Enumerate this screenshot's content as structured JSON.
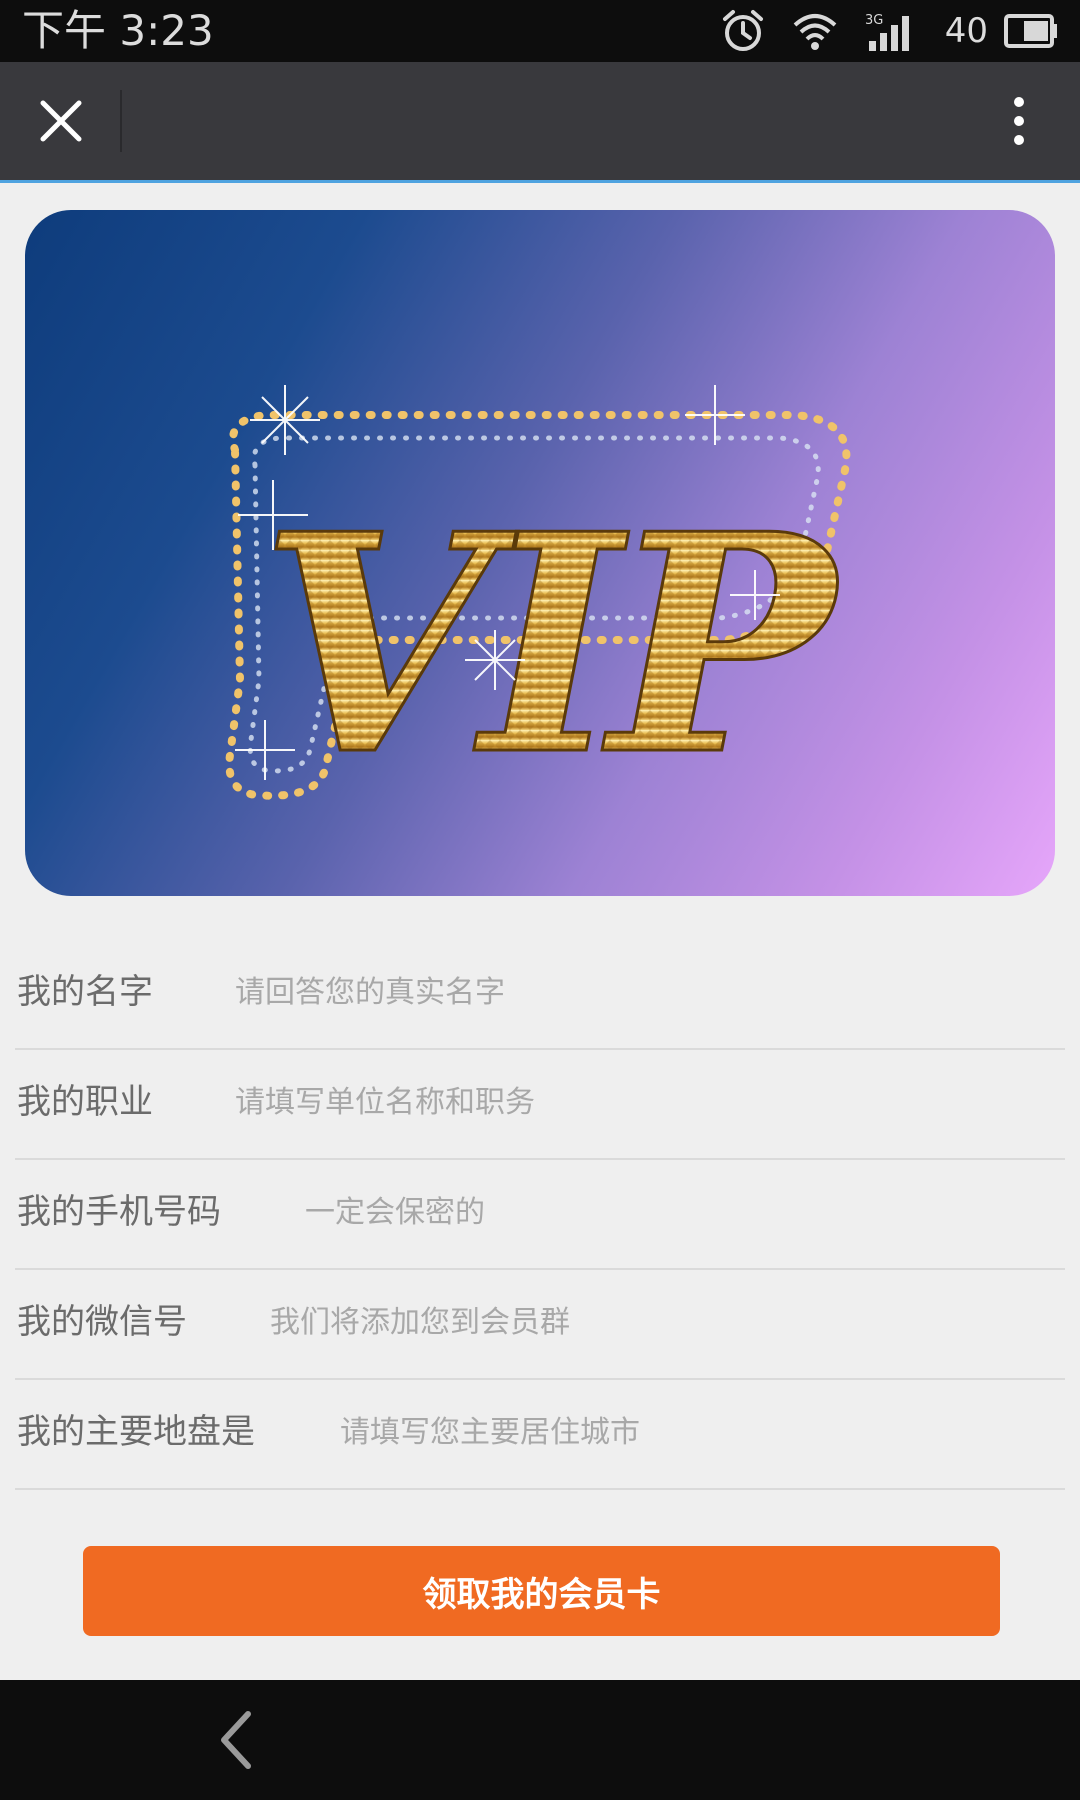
{
  "status_bar": {
    "time": "下午 3:23",
    "network_type": "3G",
    "battery_level": "40",
    "icons": [
      "alarm-clock-icon",
      "wifi-icon",
      "cellular-signal-icon",
      "battery-icon"
    ]
  },
  "app_bar": {
    "close_icon": "close-icon",
    "more_icon": "more-vertical-icon",
    "accent_color": "#4fa3e0"
  },
  "banner": {
    "text": "VIP",
    "colors": {
      "gradient_start": "#0e3c7c",
      "gradient_end": "#e6a6fa",
      "gold": "#e3b44a"
    }
  },
  "form": {
    "fields": [
      {
        "label": "我的名字",
        "placeholder": "请回答您的真实名字",
        "value": ""
      },
      {
        "label": "我的职业",
        "placeholder": "请填写单位名称和职务",
        "value": ""
      },
      {
        "label": "我的手机号码",
        "placeholder": "一定会保密的",
        "value": ""
      },
      {
        "label": "我的微信号",
        "placeholder": "我们将添加您到会员群",
        "value": ""
      },
      {
        "label": "我的主要地盘是",
        "placeholder": "请填写您主要居住城市",
        "value": ""
      }
    ]
  },
  "submit": {
    "label": "领取我的会员卡",
    "color": "#f06a22"
  },
  "nav_bar": {
    "back_icon": "back-chevron-icon"
  }
}
